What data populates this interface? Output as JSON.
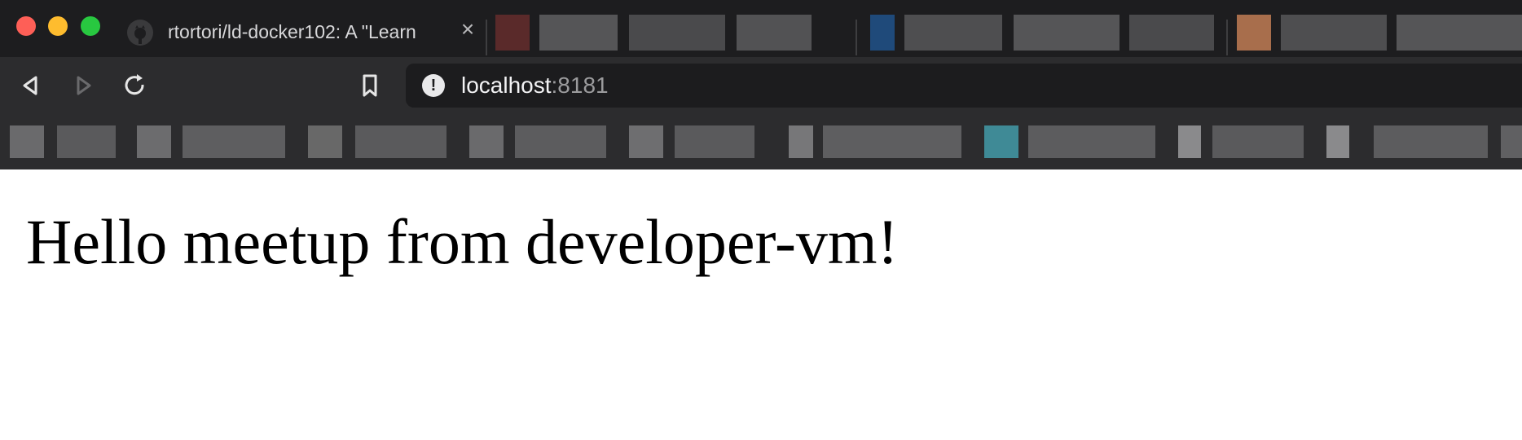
{
  "window": {
    "controls": [
      {
        "name": "close-window-button",
        "color": "#fe5f57"
      },
      {
        "name": "minimize-window-button",
        "color": "#febc2e"
      },
      {
        "name": "zoom-window-button",
        "color": "#28c840"
      }
    ]
  },
  "tabs": {
    "active": {
      "title": "rtortori/ld-docker102: A \"Learn",
      "favicon": "github-icon",
      "close_icon": "close-icon"
    }
  },
  "toolbar": {
    "back_icon": "back-arrow-icon",
    "forward_icon": "forward-arrow-icon",
    "reload_icon": "reload-icon",
    "bookmark_icon": "bookmark-icon",
    "address": {
      "security_icon": "not-secure-icon",
      "host": "localhost",
      "port": ":8181"
    }
  },
  "content": {
    "heading": "Hello meetup from developer-vm!"
  },
  "colors": {
    "chrome_dark": "#1d1d1f",
    "toolbar": "#2c2c2e",
    "address_bg": "#1c1c1e",
    "page_bg": "#ffffff"
  }
}
